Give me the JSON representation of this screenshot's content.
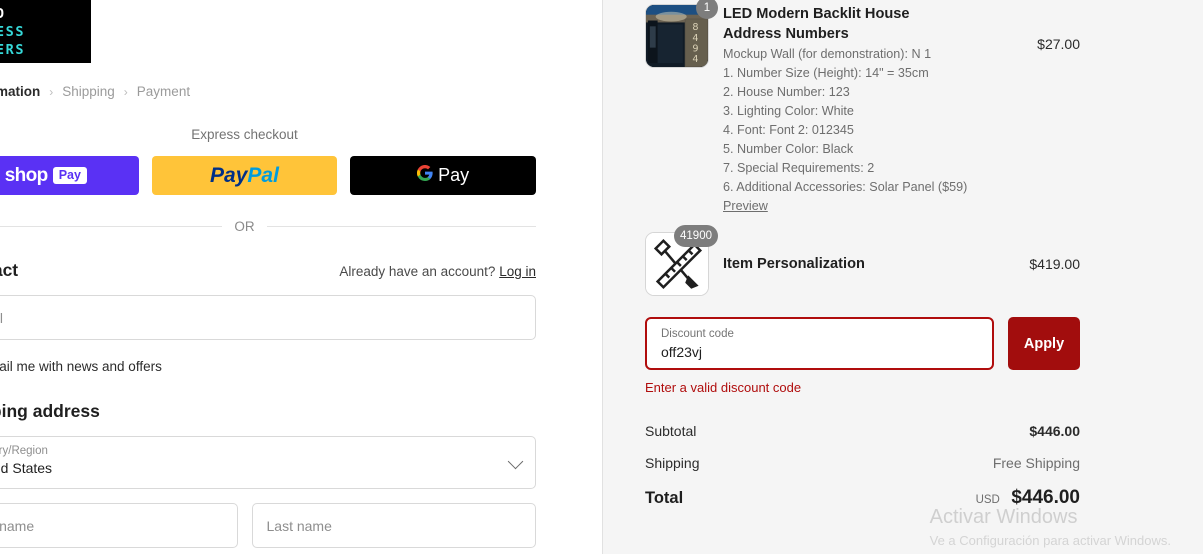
{
  "brand": {
    "logo_line1": "GHTED",
    "logo_line2": "ADDRESS",
    "logo_line3": "NUMBERS"
  },
  "breadcrumb": {
    "separator": "›",
    "items": [
      {
        "label": "Information",
        "active": true
      },
      {
        "label": "Shipping",
        "active": false
      },
      {
        "label": "Payment",
        "active": false
      }
    ]
  },
  "express": {
    "title": "Express checkout",
    "or_text": "OR",
    "buttons": [
      {
        "name": "shop-pay",
        "word": "shop",
        "pill": "Pay",
        "bg": "#5A31F4"
      },
      {
        "name": "paypal",
        "word1": "Pay",
        "word2": "Pal",
        "bg": "#FFC439"
      },
      {
        "name": "google-pay",
        "g": "G",
        "word": "Pay",
        "bg": "#000000"
      }
    ]
  },
  "contact": {
    "title": "Contact",
    "account_note": "Already have an account?",
    "login_label": "Log in",
    "email_placeholder": "Email",
    "newsletter_label": "Email me with news and offers"
  },
  "shipping_address": {
    "title": "Shipping address",
    "country_label": "Country/Region",
    "country_value": "United States",
    "first_name_placeholder": "First name",
    "last_name_placeholder": "Last name"
  },
  "summary": {
    "items": [
      {
        "name": "LED Modern Backlit House Address Numbers",
        "qty_badge": "1",
        "price": "$27.00",
        "options": [
          "Mockup Wall (for demonstration): N 1",
          "1. Number Size (Height): 14\" = 35cm",
          "2. House Number: 123",
          "3. Lighting Color: White",
          "4. Font: Font 2: 012345",
          "5. Number Color: Black",
          "7. Special Requirements: 2",
          "6. Additional Accessories: Solar Panel ($59)"
        ],
        "preview_label": "Preview",
        "thumb_numbers": "8494"
      },
      {
        "name": "Item Personalization",
        "qty_badge": "41900",
        "price": "$419.00"
      }
    ],
    "discount": {
      "label": "Discount code",
      "value": "off23vj",
      "apply_label": "Apply",
      "error": "Enter a valid discount code",
      "error_color": "#B00D0D",
      "apply_bg": "#A20D0D"
    },
    "totals": [
      {
        "label": "Subtotal",
        "value": "$446.00",
        "muted": false
      },
      {
        "label": "Shipping",
        "value": "Free Shipping",
        "muted": true
      }
    ],
    "grand_total": {
      "label": "Total",
      "currency": "USD",
      "amount": "$446.00"
    }
  },
  "watermark": {
    "title": "Activar Windows",
    "subtitle": "Ve a Configuración para activar Windows."
  }
}
